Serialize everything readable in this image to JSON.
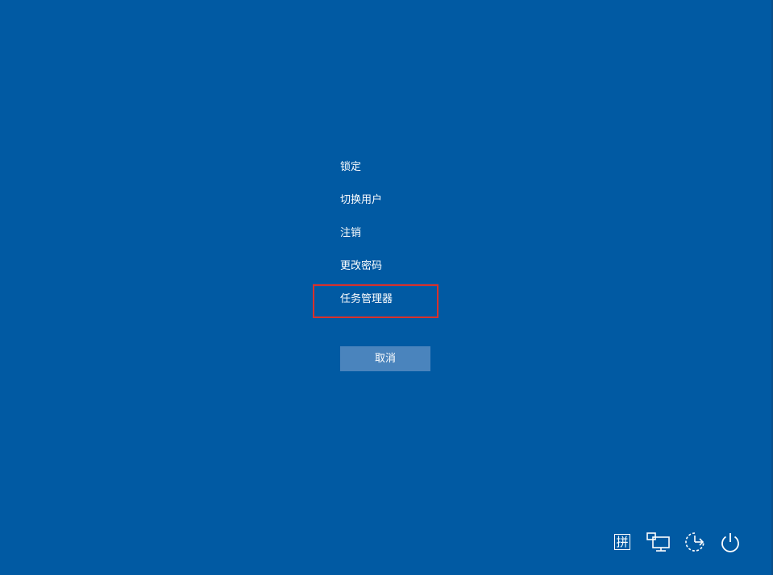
{
  "security_menu": {
    "items": [
      {
        "label": "锁定"
      },
      {
        "label": "切换用户"
      },
      {
        "label": "注销"
      },
      {
        "label": "更改密码"
      },
      {
        "label": "任务管理器",
        "highlighted": true
      }
    ],
    "cancel_label": "取消"
  },
  "tray": {
    "ime_label": "拼",
    "icons": [
      "network-icon",
      "ease-of-access-icon",
      "power-icon"
    ]
  },
  "colors": {
    "background": "#015aa3",
    "button": "#4a84bd",
    "highlight": "#d9312b",
    "text": "#ffffff"
  }
}
